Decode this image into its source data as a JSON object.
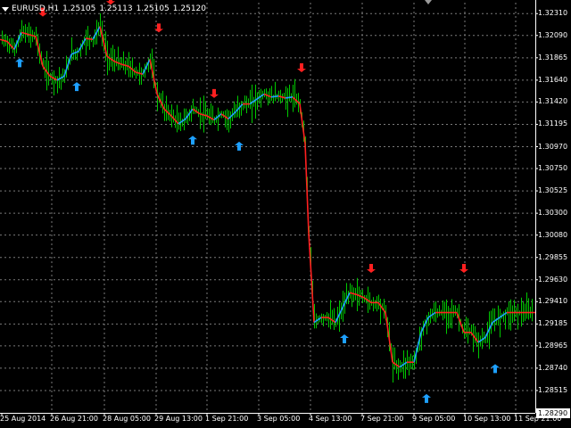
{
  "header": {
    "symbol": "EURUSD,H1",
    "prices": [
      "1.25105",
      "1.25113",
      "1.25105",
      "1.25120"
    ]
  },
  "price_axis": {
    "ticks": [
      "1.32310",
      "1.32090",
      "1.31865",
      "1.31640",
      "1.31420",
      "1.31195",
      "1.30970",
      "1.30750",
      "1.30525",
      "1.30300",
      "1.30080",
      "1.29855",
      "1.29630",
      "1.29410",
      "1.29185",
      "1.28965",
      "1.28740",
      "1.28515"
    ],
    "bid_label": "1.28290"
  },
  "time_axis": {
    "ticks": [
      "25 Aug 2014",
      "26 Aug 21:00",
      "28 Aug 05:00",
      "29 Aug 13:00",
      "1 Sep 21:00",
      "3 Sep 05:00",
      "4 Sep 13:00",
      "7 Sep 21:00",
      "9 Sep 05:00",
      "10 Sep 13:00",
      "11 Sep 21:00"
    ]
  },
  "colors": {
    "background": "#000000",
    "grid": "#7a7a7a",
    "candles": "#00c800",
    "signal_down": "#ff2020",
    "signal_up": "#1ea0ff"
  },
  "chart_data": {
    "type": "line",
    "title": "EURUSD,H1",
    "xlabel": "",
    "ylabel": "",
    "ylim": [
      1.2829,
      1.3242
    ],
    "grid": true,
    "x": [
      0,
      8,
      16,
      24,
      32,
      40,
      48,
      56,
      64,
      72,
      80,
      88,
      96,
      104,
      112,
      120,
      128,
      136,
      144,
      152,
      160,
      168,
      176,
      184,
      192,
      200,
      208,
      216,
      224,
      232,
      240,
      248,
      256,
      264,
      272,
      280,
      288,
      296,
      304,
      312,
      320,
      328,
      336,
      342,
      346,
      352,
      360,
      368,
      376,
      384,
      392,
      400,
      408,
      416,
      424,
      432,
      440,
      448,
      456,
      464,
      472,
      480,
      488,
      496,
      504,
      512,
      520,
      528,
      536,
      544,
      552,
      560,
      568,
      576,
      584,
      592,
      600
    ],
    "series": [
      {
        "name": "",
        "values": [
          1.3205,
          1.3203,
          1.3195,
          1.3212,
          1.321,
          1.3208,
          1.3178,
          1.3168,
          1.3164,
          1.3168,
          1.319,
          1.3193,
          1.3206,
          1.3205,
          1.3218,
          1.3188,
          1.3183,
          1.318,
          1.3178,
          1.3172,
          1.317,
          1.3185,
          1.315,
          1.3135,
          1.3128,
          1.312,
          1.3125,
          1.3135,
          1.313,
          1.3128,
          1.3124,
          1.313,
          1.3125,
          1.3132,
          1.314,
          1.314,
          1.3145,
          1.315,
          1.3147,
          1.3148,
          1.3146,
          1.3147,
          1.314,
          1.31,
          1.301,
          1.292,
          1.2925,
          1.2925,
          1.292,
          1.2935,
          1.295,
          1.2948,
          1.2945,
          1.294,
          1.294,
          1.293,
          1.288,
          1.2875,
          1.288,
          1.288,
          1.291,
          1.2925,
          1.293,
          1.293,
          1.293,
          1.293,
          1.291,
          1.291,
          1.29,
          1.2905,
          1.292,
          1.2925,
          1.293,
          1.293,
          1.293,
          1.293,
          1.293
        ]
      }
    ],
    "signals_down": [
      [
        48,
        1.3228
      ],
      [
        124,
        1.324
      ],
      [
        178,
        1.3212
      ],
      [
        240,
        1.3146
      ],
      [
        338,
        1.3172
      ],
      [
        416,
        1.297
      ],
      [
        520,
        1.297
      ]
    ],
    "signals_up": [
      [
        22,
        1.3186
      ],
      [
        86,
        1.3162
      ],
      [
        216,
        1.3108
      ],
      [
        268,
        1.3102
      ],
      [
        386,
        1.2908
      ],
      [
        478,
        1.2848
      ],
      [
        555,
        1.2878
      ]
    ]
  }
}
